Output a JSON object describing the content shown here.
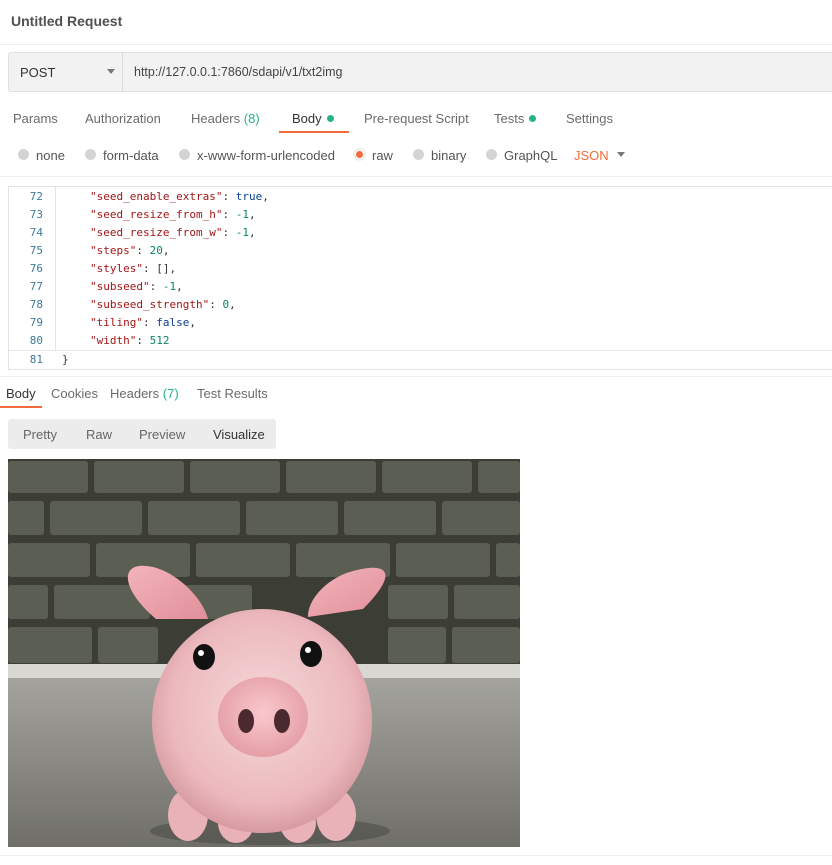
{
  "request": {
    "title": "Untitled Request",
    "method": "POST",
    "url": "http://127.0.0.1:7860/sdapi/v1/txt2img"
  },
  "request_tabs": [
    {
      "label": "Params"
    },
    {
      "label": "Authorization"
    },
    {
      "label": "Headers",
      "count": "(8)"
    },
    {
      "label": "Body",
      "dot": true
    },
    {
      "label": "Pre-request Script"
    },
    {
      "label": "Tests",
      "dot": true
    },
    {
      "label": "Settings"
    }
  ],
  "body_options": {
    "items": [
      "none",
      "form-data",
      "x-www-form-urlencoded",
      "raw",
      "binary",
      "GraphQL"
    ],
    "selected": "raw",
    "format": "JSON"
  },
  "editor": {
    "lines": [
      {
        "num": "72",
        "key": "\"seed_enable_extras\"",
        "value": "true"
      },
      {
        "num": "73",
        "key": "\"seed_resize_from_h\"",
        "value": "-1"
      },
      {
        "num": "74",
        "key": "\"seed_resize_from_w\"",
        "value": "-1"
      },
      {
        "num": "75",
        "key": "\"steps\"",
        "value": "20"
      },
      {
        "num": "76",
        "key": "\"styles\"",
        "value": "[]"
      },
      {
        "num": "77",
        "key": "\"subseed\"",
        "value": "-1"
      },
      {
        "num": "78",
        "key": "\"subseed_strength\"",
        "value": "0"
      },
      {
        "num": "79",
        "key": "\"tiling\"",
        "value": "false"
      },
      {
        "num": "80",
        "key": "\"width\"",
        "value": "512"
      },
      {
        "num": "81",
        "closing": "}"
      }
    ]
  },
  "response_tabs": [
    {
      "label": "Body"
    },
    {
      "label": "Cookies"
    },
    {
      "label": "Headers",
      "count": "(7)"
    },
    {
      "label": "Test Results"
    }
  ],
  "view_modes": [
    "Pretty",
    "Raw",
    "Preview",
    "Visualize"
  ],
  "colors": {
    "accent": "#f26b3a",
    "success": "#26b47f",
    "code_key": "#a31515",
    "code_bool": "#0b3d91",
    "code_number": "#098658"
  },
  "icons": {
    "method_dropdown": "chevron-down-icon",
    "format_dropdown": "chevron-down-icon"
  }
}
